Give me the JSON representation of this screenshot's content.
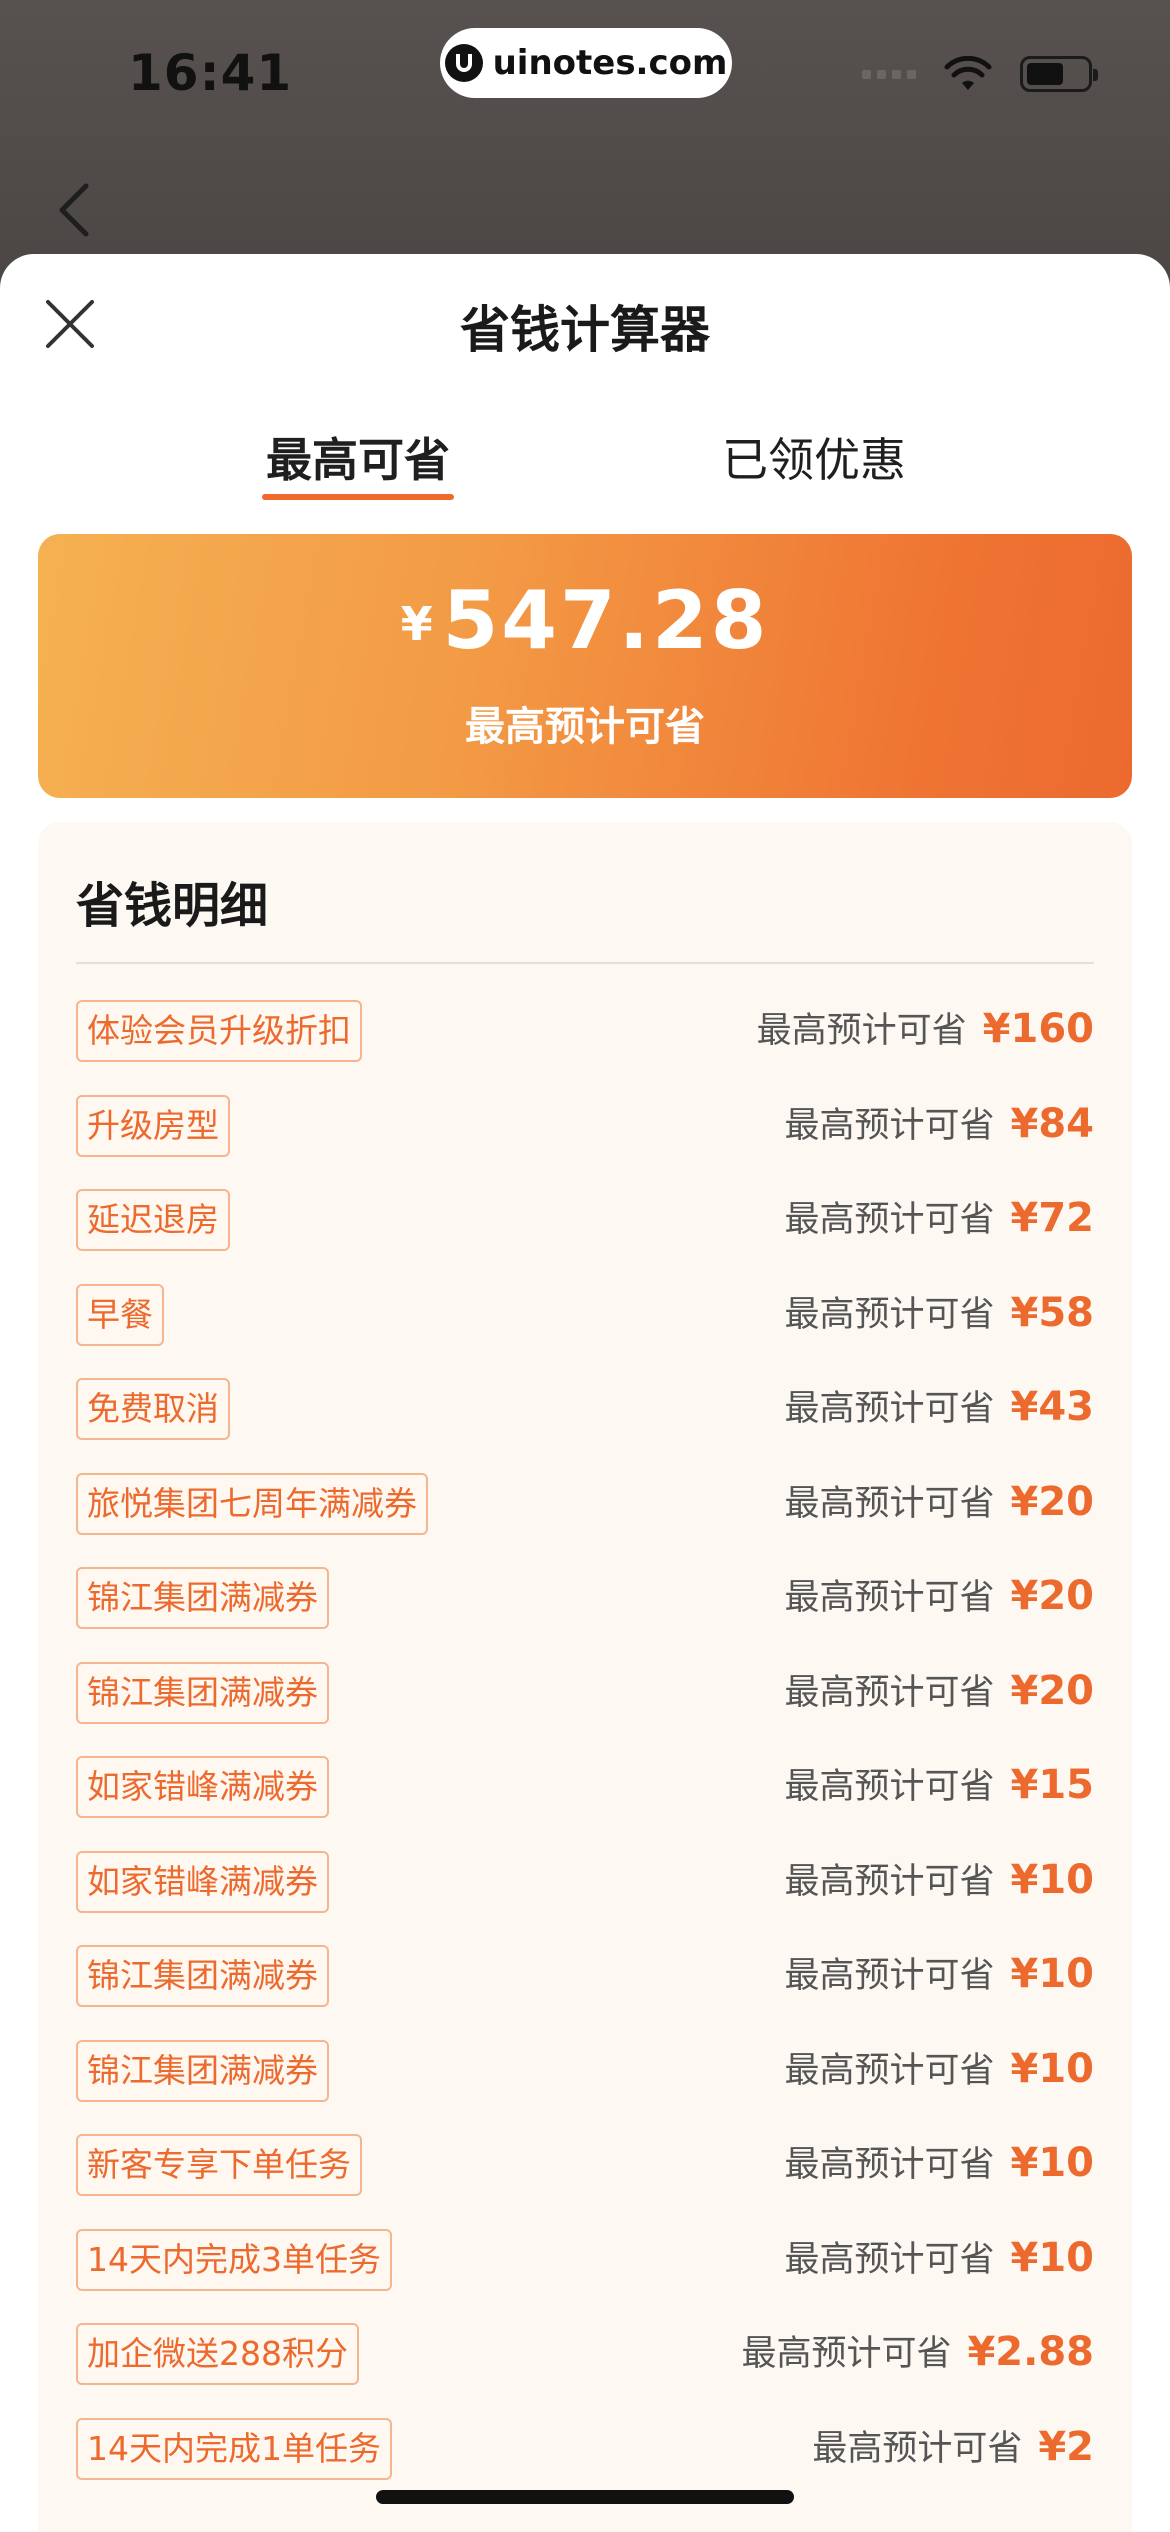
{
  "status": {
    "time": "16:41",
    "url": "uinotes.com"
  },
  "sheet": {
    "title": "省钱计算器",
    "tabs": [
      {
        "label": "最高可省",
        "active": true
      },
      {
        "label": "已领优惠",
        "active": false
      }
    ]
  },
  "summary": {
    "currency": "¥",
    "amount": "547.28",
    "caption": "最高预计可省"
  },
  "detail": {
    "title": "省钱明细",
    "rows": [
      {
        "tag": "体验会员升级折扣",
        "label": "最高预计可省",
        "amount": "¥160"
      },
      {
        "tag": "升级房型",
        "label": "最高预计可省",
        "amount": "¥84"
      },
      {
        "tag": "延迟退房",
        "label": "最高预计可省",
        "amount": "¥72"
      },
      {
        "tag": "早餐",
        "label": "最高预计可省",
        "amount": "¥58"
      },
      {
        "tag": "免费取消",
        "label": "最高预计可省",
        "amount": "¥43"
      },
      {
        "tag": "旅悦集团七周年满减券",
        "label": "最高预计可省",
        "amount": "¥20"
      },
      {
        "tag": "锦江集团满减券",
        "label": "最高预计可省",
        "amount": "¥20"
      },
      {
        "tag": "锦江集团满减券",
        "label": "最高预计可省",
        "amount": "¥20"
      },
      {
        "tag": "如家错峰满减券",
        "label": "最高预计可省",
        "amount": "¥15"
      },
      {
        "tag": "如家错峰满减券",
        "label": "最高预计可省",
        "amount": "¥10"
      },
      {
        "tag": "锦江集团满减券",
        "label": "最高预计可省",
        "amount": "¥10"
      },
      {
        "tag": "锦江集团满减券",
        "label": "最高预计可省",
        "amount": "¥10"
      },
      {
        "tag": "新客专享下单任务",
        "label": "最高预计可省",
        "amount": "¥10"
      },
      {
        "tag": "14天内完成3单任务",
        "label": "最高预计可省",
        "amount": "¥10"
      },
      {
        "tag": "加企微送288积分",
        "label": "最高预计可省",
        "amount": "¥2.88"
      },
      {
        "tag": "14天内完成1单任务",
        "label": "最高预计可省",
        "amount": "¥2"
      }
    ]
  },
  "colors": {
    "accent": "#ec6a2e",
    "hero_start": "#f5b152",
    "hero_end": "#ec6a2e"
  },
  "icons": {
    "close": "close-icon",
    "back": "chevron-left-icon",
    "wifi": "wifi-icon",
    "battery": "battery-icon"
  }
}
